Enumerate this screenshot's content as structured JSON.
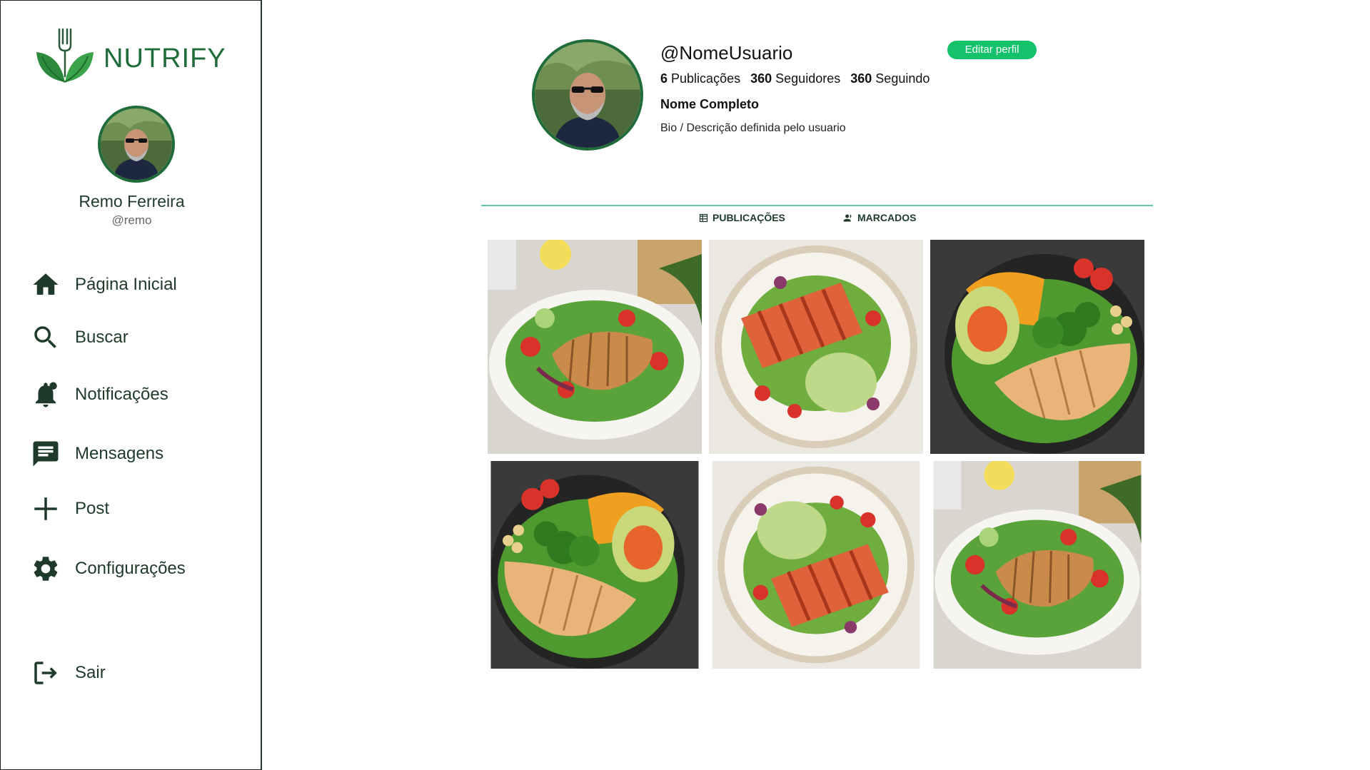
{
  "app": {
    "name": "NUTRIFY"
  },
  "sidebar": {
    "user": {
      "name": "Remo Ferreira",
      "handle": "@remo"
    },
    "items": [
      {
        "label": "Página Inicial",
        "icon": "home-icon"
      },
      {
        "label": "Buscar",
        "icon": "search-icon"
      },
      {
        "label": "Notificações",
        "icon": "bell-icon"
      },
      {
        "label": "Mensagens",
        "icon": "message-icon"
      },
      {
        "label": "Post",
        "icon": "plus-icon"
      },
      {
        "label": "Configurações",
        "icon": "gear-icon"
      }
    ],
    "logout": {
      "label": "Sair",
      "icon": "logout-icon"
    }
  },
  "profile": {
    "username": "@NomeUsuario",
    "edit_label": "Editar perfil",
    "posts_count": "6",
    "posts_label": "Publicações",
    "followers_count": "360",
    "followers_label": "Seguidores",
    "following_count": "360",
    "following_label": "Seguindo",
    "full_name": "Nome Completo",
    "bio": "Bio / Descrição definida pelo usuario"
  },
  "tabs": [
    {
      "label": "PUBLICAÇÕES",
      "icon": "grid-icon"
    },
    {
      "label": "MARCADOS",
      "icon": "people-icon"
    }
  ],
  "posts": [
    {
      "kind": "chicken-salad"
    },
    {
      "kind": "salmon-guacamole"
    },
    {
      "kind": "chicken-avocado-bowl"
    },
    {
      "kind": "chicken-avocado-bowl"
    },
    {
      "kind": "salmon-guacamole"
    },
    {
      "kind": "chicken-salad"
    }
  ],
  "colors": {
    "brand": "#1f6b3a",
    "accent": "#13c26b",
    "divider": "#5fc9a0"
  }
}
